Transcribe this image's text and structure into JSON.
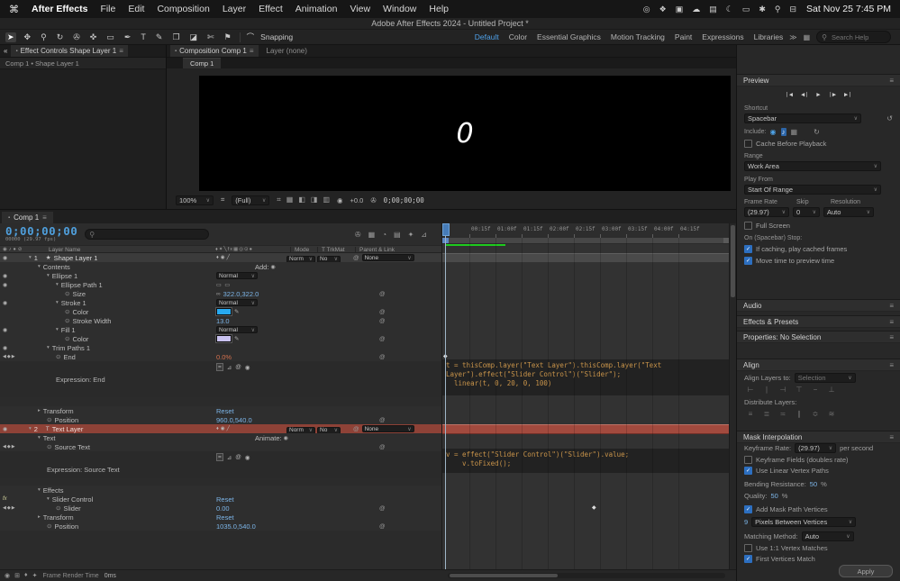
{
  "icons": {
    "menu": "≡",
    "caret": "∨",
    "collapse": "«",
    "panel_dot": "▪",
    "check": "✓",
    "search": "⚲",
    "reset": "↺",
    "loop": "↻",
    "eye": "◉",
    "audio": "♪",
    "grid": "▦",
    "lock": "⊘",
    "stopwatch": "⊙",
    "pickwhip": "@",
    "star": "★",
    "T": "T",
    "twirl_open": "▾",
    "twirl_closed": "▸",
    "kf_nav": "◀◆▶",
    "diamond": "◆",
    "add_dot": "◉",
    "chain": "∞",
    "eyedrop": "✎",
    "path_rects": "▭ ▭",
    "attr_header": "♦✦╲fx▦◎⊙●",
    "attr_layer": "♦◉╱",
    "expr_icons": [
      "=",
      "⊿",
      "@",
      "◉"
    ],
    "overflow": "≫",
    "camera": "✇",
    "safe_areas": "⌗",
    "exposure": "◉",
    "magnet": "⌒",
    "av_header": "◉♪●⊘"
  },
  "menubar": {
    "apple_icon": "⌘",
    "items": [
      "After Effects",
      "File",
      "Edit",
      "Composition",
      "Layer",
      "Effect",
      "Animation",
      "View",
      "Window",
      "Help"
    ],
    "status_icons": [
      {
        "name": "screen-mirroring-icon",
        "glyph": "◎"
      },
      {
        "name": "creative-cloud-icon",
        "glyph": "❖"
      },
      {
        "name": "drive-icon",
        "glyph": "▣"
      },
      {
        "name": "cloud-icon",
        "glyph": "☁"
      },
      {
        "name": "display-icon",
        "glyph": "▤"
      },
      {
        "name": "moon-icon",
        "glyph": "☾"
      },
      {
        "name": "battery-icon",
        "glyph": "▭"
      },
      {
        "name": "wifi-icon",
        "glyph": "✱"
      },
      {
        "name": "spotlight-icon",
        "glyph": "⚲"
      },
      {
        "name": "control-center-icon",
        "glyph": "⊟"
      }
    ],
    "clock": "Sat Nov 25 7:45 PM"
  },
  "titlebar": {
    "title": "Adobe After Effects 2024 - Untitled Project *"
  },
  "toolbar": {
    "tools": [
      {
        "name": "selection-tool",
        "glyph": "➤",
        "active": true
      },
      {
        "name": "hand-tool",
        "glyph": "✥"
      },
      {
        "name": "zoom-tool",
        "glyph": "⚲"
      },
      {
        "name": "orbit-camera-tool",
        "glyph": "↻"
      },
      {
        "name": "camera-tool",
        "glyph": "✇"
      },
      {
        "name": "pan-behind-tool",
        "glyph": "✜"
      },
      {
        "name": "shape-tool",
        "glyph": "▭"
      },
      {
        "name": "pen-tool",
        "glyph": "✒"
      },
      {
        "name": "type-tool",
        "glyph": "T"
      },
      {
        "name": "brush-tool",
        "glyph": "✎"
      },
      {
        "name": "clone-stamp-tool",
        "glyph": "❐"
      },
      {
        "name": "eraser-tool",
        "glyph": "◪"
      },
      {
        "name": "roto-brush-tool",
        "glyph": "✄"
      },
      {
        "name": "puppet-pin-tool",
        "glyph": "⚑"
      }
    ],
    "snapping": "Snapping",
    "workspaces": [
      "Default",
      "Color",
      "Essential Graphics",
      "Motion Tracking",
      "Paint",
      "Expressions",
      "Libraries"
    ],
    "search_placeholder": "Search Help"
  },
  "effect_controls": {
    "tab": "Effect Controls Shape Layer 1",
    "breadcrumb": "Comp 1 • Shape Layer 1"
  },
  "composition": {
    "tab_composition": "Composition Comp 1",
    "tab_layer": "Layer (none)",
    "viewer_tab": "Comp 1",
    "overlay_text": "0",
    "zoom": "100%",
    "resolution": "(Full)",
    "exposure": "+0.0",
    "timecode": "0;00;00;00",
    "bottom_icons": [
      {
        "name": "choose-grid-icon",
        "glyph": "⌗"
      },
      {
        "name": "mask-visibility-icon",
        "glyph": "▦"
      },
      {
        "name": "region-of-interest-icon",
        "glyph": "◧"
      },
      {
        "name": "transparency-grid-icon",
        "glyph": "◨"
      },
      {
        "name": "channels-icon",
        "glyph": "▥"
      }
    ]
  },
  "preview": {
    "title": "Preview",
    "transport": [
      {
        "name": "first-frame-button",
        "glyph": "❘◀"
      },
      {
        "name": "previous-frame-button",
        "glyph": "◀❘"
      },
      {
        "name": "play-button",
        "glyph": "▶"
      },
      {
        "name": "next-frame-button",
        "glyph": "❘▶"
      },
      {
        "name": "last-frame-button",
        "glyph": "▶❘"
      }
    ],
    "shortcut_label": "Shortcut",
    "shortcut": "Spacebar",
    "include_label": "Include:",
    "include_icons": [
      {
        "name": "include-video-toggle",
        "glyph": "◉",
        "on": true
      },
      {
        "name": "include-audio-toggle",
        "glyph": "♪",
        "on": true,
        "boxed": true
      },
      {
        "name": "include-overlays-toggle",
        "glyph": "▦"
      }
    ],
    "cache_label": "Cache Before Playback",
    "range_label": "Range",
    "range": "Work Area",
    "playfrom_label": "Play From",
    "playfrom": "Start Of Range",
    "framerate_label": "Frame Rate",
    "skip_label": "Skip",
    "resolution_label": "Resolution",
    "framerate": "(29.97)",
    "skip": "0",
    "resolution": "Auto",
    "fullscreen_label": "Full Screen",
    "stop_label": "On (Spacebar) Stop:",
    "caching_label": "If caching, play cached frames",
    "movetime_label": "Move time to preview time"
  },
  "collapsed_panels": {
    "audio": "Audio",
    "effects_presets": "Effects & Presets",
    "properties": "Properties: No Selection"
  },
  "align": {
    "title": "Align",
    "align_layers_label": "Align Layers to:",
    "align_to": "Selection",
    "align_buttons": [
      {
        "name": "align-left-button",
        "glyph": "⊢"
      },
      {
        "name": "align-h-center-button",
        "glyph": "∣"
      },
      {
        "name": "align-right-button",
        "glyph": "⊣"
      },
      {
        "name": "align-top-button",
        "glyph": "⊤"
      },
      {
        "name": "align-v-center-button",
        "glyph": "−"
      },
      {
        "name": "align-bottom-button",
        "glyph": "⊥"
      }
    ],
    "distribute_label": "Distribute Layers:",
    "distribute_buttons": [
      {
        "name": "distribute-top-button",
        "glyph": "≡"
      },
      {
        "name": "distribute-v-center-button",
        "glyph": "≣"
      },
      {
        "name": "distribute-bottom-button",
        "glyph": "≍"
      },
      {
        "name": "distribute-left-button",
        "glyph": "∥"
      },
      {
        "name": "distribute-h-center-button",
        "glyph": "≎"
      },
      {
        "name": "distribute-right-button",
        "glyph": "≋"
      }
    ]
  },
  "mask_interpolation": {
    "title": "Mask Interpolation",
    "keyframe_rate_label": "Keyframe Rate:",
    "keyframe_rate": "(29.97)",
    "per_second": "per second",
    "fields_label": "Keyframe Fields (doubles rate)",
    "linear_label": "Use Linear Vertex Paths",
    "bending_label": "Bending Resistance:",
    "bending": "50",
    "percent": "%",
    "quality_label": "Quality:",
    "quality": "50",
    "addverts_label": "Add Mask Path Vertices",
    "verts_value": "9",
    "verts_unit": "Pixels Between Vertices",
    "matching_label": "Matching Method:",
    "matching": "Auto",
    "use11_label": "Use 1:1 Vertex Matches",
    "firstv_label": "First Vertices Match",
    "apply": "Apply"
  },
  "timeline": {
    "tab": "Comp 1",
    "timecode": "0;00;00;00",
    "frames": "00000 (29.97 fps)",
    "head_icons": [
      {
        "name": "composition-mini-flowchart-icon",
        "glyph": "✇"
      },
      {
        "name": "draft-3d-icon",
        "glyph": "▦"
      },
      {
        "name": "shy-layers-icon",
        "glyph": "◔"
      },
      {
        "name": "frame-blending-icon",
        "glyph": "▤"
      },
      {
        "name": "motion-blur-icon",
        "glyph": "✦"
      },
      {
        "name": "graph-editor-icon",
        "glyph": "⊿"
      }
    ],
    "cols": {
      "layer_name": "Layer Name",
      "mode": "Mode",
      "trkmat": "T TrkMat",
      "parent": "Parent & Link"
    },
    "rows": [
      {
        "type": "layer",
        "eye": true,
        "num": "1",
        "icon": "star",
        "twirl": "open",
        "label": "Shape Layer 1",
        "attrs": true,
        "mode": "Norm",
        "trkmat": "No",
        "parent": "None"
      },
      {
        "type": "group",
        "ind": 1,
        "twirl": "open",
        "label": "Contents",
        "add_label": "Add:"
      },
      {
        "type": "group",
        "ind": 2,
        "twirl": "open",
        "eye": true,
        "label": "Ellipse 1",
        "blend": "Normal"
      },
      {
        "type": "group",
        "ind": 3,
        "twirl": "open",
        "eye": true,
        "label": "Ellipse Path 1",
        "path_icons": true
      },
      {
        "type": "prop",
        "ind": 4,
        "sw": true,
        "label": "Size",
        "link": true,
        "value": "322.0,322.0",
        "vcolor": "blue",
        "pick": true
      },
      {
        "type": "group",
        "ind": 3,
        "twirl": "open",
        "eye": true,
        "label": "Stroke 1",
        "blend": "Normal"
      },
      {
        "type": "prop",
        "ind": 4,
        "sw": true,
        "label": "Color",
        "swatch": "#27aaf2",
        "pick": true
      },
      {
        "type": "prop",
        "ind": 4,
        "sw": true,
        "label": "Stroke Width",
        "value": "13.0",
        "vcolor": "blue",
        "pick": true
      },
      {
        "type": "group",
        "ind": 3,
        "twirl": "open",
        "eye": true,
        "label": "Fill 1",
        "blend": "Normal"
      },
      {
        "type": "prop",
        "ind": 4,
        "sw": true,
        "label": "Color",
        "swatch": "#c9c2f0",
        "pick": true
      },
      {
        "type": "group",
        "ind": 2,
        "twirl": "open",
        "eye": true,
        "label": "Trim Paths 1"
      },
      {
        "type": "prop",
        "ind": 3,
        "sw": true,
        "kf": true,
        "label": "End",
        "value": "0.0%",
        "vcolor": "red",
        "pick": true
      },
      {
        "type": "expr",
        "h": 40,
        "ind": 3,
        "label": "Expression: End"
      },
      {
        "type": "spacer",
        "h": 10
      },
      {
        "type": "group",
        "ind": 1,
        "twirl": "closed",
        "label": "Transform",
        "value": "Reset",
        "vcolor": "blue"
      },
      {
        "type": "prop",
        "ind": 2,
        "sw": true,
        "label": "Position",
        "value": "960.0,540.0",
        "vcolor": "blue",
        "pick": true
      },
      {
        "type": "layer",
        "selected": true,
        "eye": true,
        "num": "2",
        "icon": "T",
        "twirl": "open",
        "label": "Text Layer",
        "attrs": true,
        "mode": "Norm",
        "trkmat": "No",
        "parent": "None"
      },
      {
        "type": "group",
        "ind": 1,
        "twirl": "open",
        "label": "Text",
        "add_label": "Animate:"
      },
      {
        "type": "prop",
        "ind": 2,
        "sw": true,
        "kf": true,
        "label": "Source Text",
        "pick": true
      },
      {
        "type": "expr",
        "h": 30,
        "ind": 2,
        "label": "Expression: Source Text"
      },
      {
        "type": "spacer",
        "h": 8
      },
      {
        "type": "group",
        "ind": 1,
        "twirl": "open",
        "label": "Effects"
      },
      {
        "type": "group",
        "ind": 2,
        "twirl": "open",
        "fx": true,
        "label": "Slider Control",
        "value": "Reset",
        "vcolor": "blue"
      },
      {
        "type": "prop",
        "ind": 3,
        "sw": true,
        "kf": true,
        "label": "Slider",
        "value": "0.00",
        "vcolor": "blue",
        "pick": true
      },
      {
        "type": "group",
        "ind": 1,
        "twirl": "closed",
        "label": "Transform",
        "value": "Reset",
        "vcolor": "blue"
      },
      {
        "type": "prop",
        "ind": 2,
        "sw": true,
        "label": "Position",
        "value": "1035.0,540.0",
        "vcolor": "blue",
        "pick": true
      }
    ],
    "status_label": "Frame Render Time",
    "status_value": "0ms"
  },
  "graph": {
    "ruler": [
      "00:15f",
      "01:00f",
      "01:15f",
      "02:00f",
      "02:15f",
      "03:00f",
      "03:15f",
      "04:00f",
      "04:15f"
    ],
    "code1": "t = thisComp.layer(\"Text Layer\").thisComp.layer(\"Text\nLayer\").effect(\"Slider Control\")(\"Slider\");\n  linear(t, 0, 20, 0, 100)",
    "code2": "v = effect(\"Slider Control\")(\"Slider\").value;\n    v.toFixed();"
  }
}
